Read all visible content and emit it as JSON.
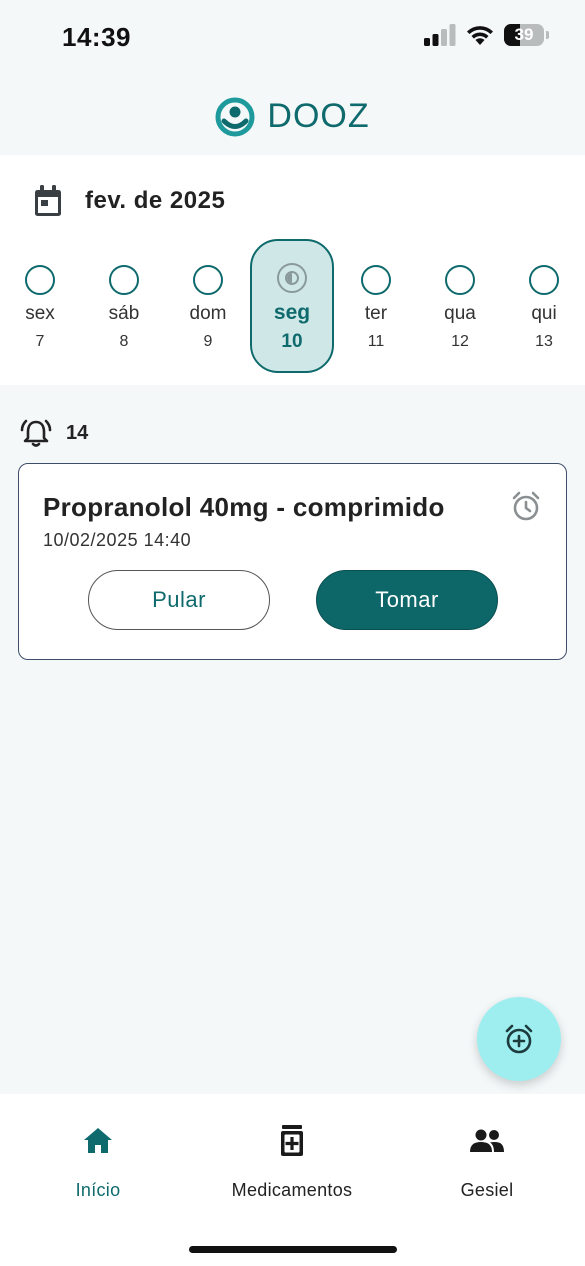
{
  "status_bar": {
    "time": "14:39",
    "battery_level": "39",
    "icons": [
      "signal-icon",
      "wifi-icon",
      "battery-icon"
    ]
  },
  "header": {
    "app_name": "DOOZ",
    "logo_icon": "dooz-logo-icon"
  },
  "calendar": {
    "month": "fev. de 2025",
    "days": [
      {
        "name": "sex",
        "num": "7",
        "selected": false
      },
      {
        "name": "sáb",
        "num": "8",
        "selected": false
      },
      {
        "name": "dom",
        "num": "9",
        "selected": false
      },
      {
        "name": "seg",
        "num": "10",
        "selected": true
      },
      {
        "name": "ter",
        "num": "11",
        "selected": false
      },
      {
        "name": "qua",
        "num": "12",
        "selected": false
      },
      {
        "name": "qui",
        "num": "13",
        "selected": false
      }
    ]
  },
  "alarms": {
    "count": "14",
    "items": [
      {
        "title": "Propranolol 40mg - comprimido",
        "datetime": "10/02/2025 14:40",
        "skip_label": "Pular",
        "take_label": "Tomar"
      }
    ]
  },
  "nav": {
    "items": [
      {
        "label": "Início",
        "icon": "home-icon",
        "active": true
      },
      {
        "label": "Medicamentos",
        "icon": "medication-icon",
        "active": false
      },
      {
        "label": "Gesiel",
        "icon": "people-icon",
        "active": false
      }
    ]
  },
  "colors": {
    "primary": "#0f6a6d",
    "selected_day_bg": "#cfe8e7",
    "fab_bg": "#9eeef0",
    "background": "#f4f8f9"
  }
}
